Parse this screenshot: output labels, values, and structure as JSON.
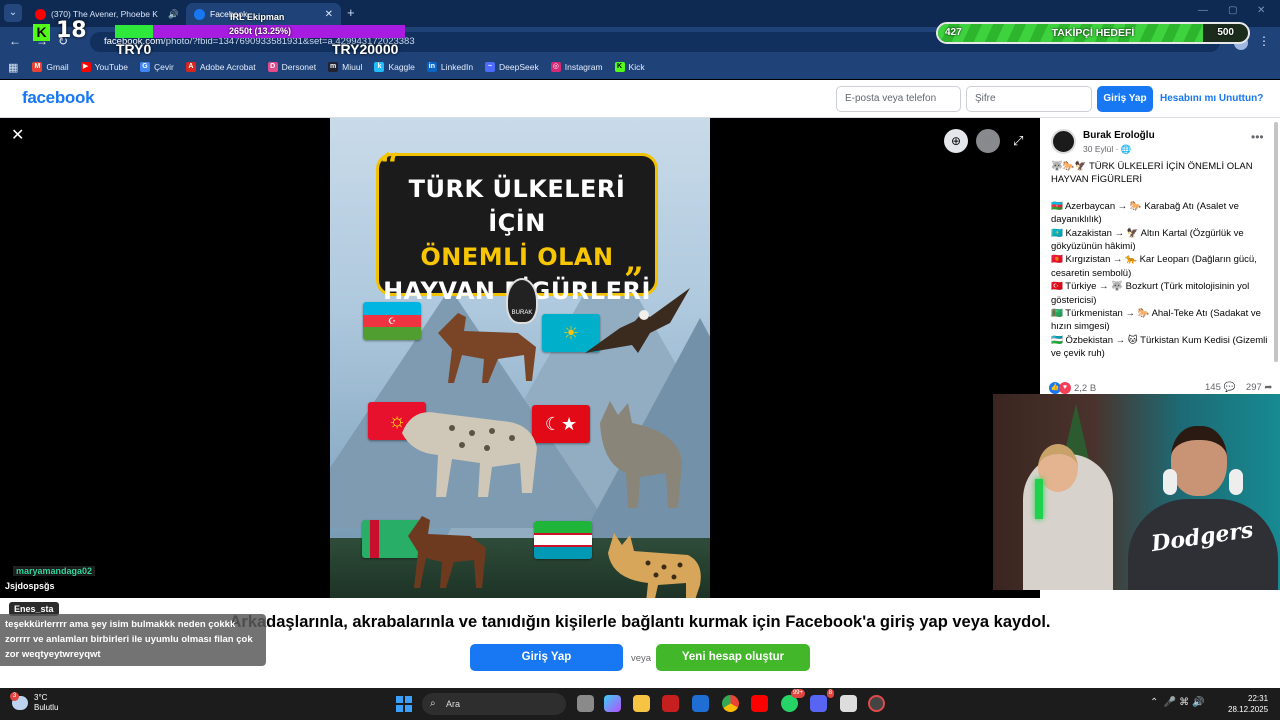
{
  "browser": {
    "tabs": [
      {
        "label": "(370) The Avener, Phoebe K",
        "favicon": "youtube-icon",
        "active": false
      },
      {
        "label": "Facebook",
        "favicon": "facebook-icon",
        "active": true
      }
    ],
    "url_host": "facebook.com",
    "url_path": "/photo/?fbid=1347690933581931&set=a.429943172023383",
    "bookmarks": [
      "Gmail",
      "YouTube",
      "Çevir",
      "Adobe Acrobat",
      "Dersonet",
      "Miuul",
      "Kaggle",
      "LinkedIn",
      "DeepSeek",
      "Instagram",
      "Kick"
    ]
  },
  "stream_overlay": {
    "kick_count": "18",
    "ekip_label": "IRL Ekipman",
    "goal_text": "2650t (13.25%)",
    "goal_progress": 0.1325,
    "goal_start": "TRY0",
    "goal_end": "TRY20000",
    "follower_current": "427",
    "follower_label": "TAKİPÇİ HEDEFİ",
    "follower_goal": "500",
    "follower_progress": 0.854
  },
  "fb_header": {
    "logo": "facebook",
    "email_placeholder": "E-posta veya telefon",
    "password_placeholder": "Şifre",
    "login_label": "Giriş Yap",
    "forgot_label": "Hesabını mı Unuttun?"
  },
  "photo": {
    "title_line1": "TÜRK ÜLKELERİ İÇİN",
    "title_line2": "ÖNEMLİ OLAN",
    "title_line3": "HAYVAN FİGÜRLERİ",
    "badge": "BURAK"
  },
  "post": {
    "author": "Burak Eroloğlu",
    "date": "30 Eylül · 🌐",
    "lines": [
      "🐺🐎🦅 TÜRK ÜLKELERİ İÇİN ÖNEMLİ OLAN HAYVAN FİGÜRLERİ",
      "",
      "🇦🇿 Azerbaycan → 🐎 Karabağ Atı (Asalet ve dayanıklılık)",
      "🇰🇿 Kazakistan → 🦅 Altın Kartal (Özgürlük ve gökyüzünün hâkimi)",
      "🇰🇬 Kırgızistan → 🐆 Kar Leoparı (Dağların gücü, cesaretin sembolü)",
      "🇹🇷 Türkiye → 🐺 Bozkurt (Türk mitolojisinin yol göstericisi)",
      "🇹🇲 Türkmenistan → 🐎 Ahal-Teke Atı (Sadakat ve hızın simgesi)",
      "🇺🇿 Özbekistan → 🐱 Türkistan Kum Kedisi (Gizemli ve çevik ruh)"
    ],
    "reactions": "2,2 B",
    "comments": "145",
    "shares": "297"
  },
  "chat": {
    "user1": "maryamandaga02",
    "user2": "Jsjdospsğs",
    "user3": "Enes_sta",
    "message": "teşekkürlerrrr ama şey isim bulmakkk neden çokkk zorrrr ve anlamları birbirleri ile uyumlu olması filan çok zor weqtyeytwreyqwt"
  },
  "banner": {
    "text": "Arkadaşlarınla, akrabalarınla ve tanıdığın kişilerle bağlantı kurmak için Facebook'a giriş yap veya kaydol.",
    "login": "Giriş Yap",
    "or": "veya",
    "signup": "Yeni hesap oluştur"
  },
  "webcam": {
    "shirt_text": "Dodgers"
  },
  "taskbar": {
    "temp": "3°C",
    "weather": "Bulutlu",
    "weather_badge": "3",
    "search_placeholder": "Ara",
    "whatsapp_badge": "99+",
    "discord_badge": "8",
    "time": "22:31",
    "date": "28.12.2025"
  },
  "colors": {
    "facebook_blue": "#1877f2",
    "signup_green": "#42b72a",
    "browser_frame": "#1f4379",
    "kick_green": "#53fc18",
    "goal_purple": "#a81be0"
  }
}
